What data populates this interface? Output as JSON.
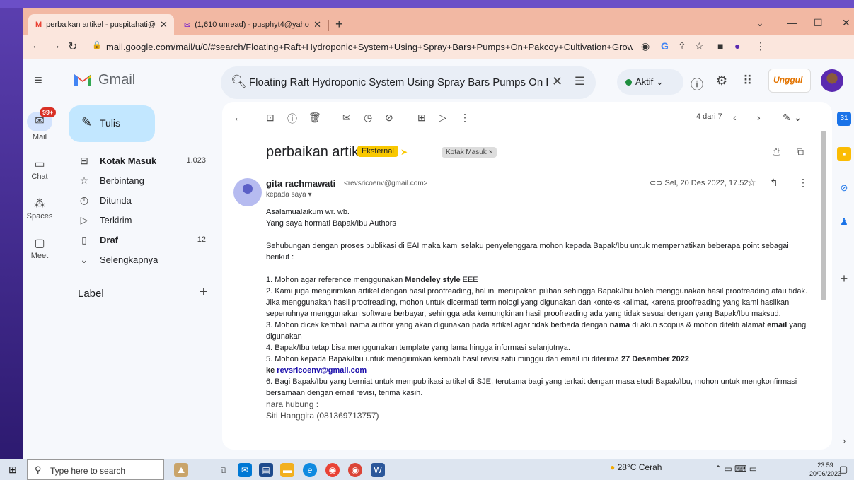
{
  "browser": {
    "tabs": [
      {
        "title": "perbaikan artikel - puspitahati@",
        "icon": "gmail-icon"
      },
      {
        "title": "(1,610 unread) - pusphyt4@yaho",
        "icon": "yahoo-mail-icon"
      }
    ],
    "new_tab": "+",
    "url": "mail.google.com/mail/u/0/#search/Floating+Raft+Hydroponic+System+Using+Spray+Bars+Pumps+On+Pakcoy+Cultivation+Growth+(Brassica+rapa+L)..."
  },
  "gmail": {
    "app_name": "Gmail",
    "search_query": "Floating Raft Hydroponic System Using Spray Bars Pumps On Pa",
    "status": "Aktif",
    "account_brand": "Unggul"
  },
  "rail": {
    "badge": "99+",
    "items": [
      {
        "label": "Mail",
        "icon": "mail-icon"
      },
      {
        "label": "Chat",
        "icon": "chat-icon"
      },
      {
        "label": "Spaces",
        "icon": "spaces-icon"
      },
      {
        "label": "Meet",
        "icon": "video-icon"
      }
    ]
  },
  "sidebar": {
    "compose": "Tulis",
    "items": [
      {
        "label": "Kotak Masuk",
        "count": "1.023",
        "icon": "inbox-icon"
      },
      {
        "label": "Berbintang",
        "count": "",
        "icon": "star-icon"
      },
      {
        "label": "Ditunda",
        "count": "",
        "icon": "clock-icon"
      },
      {
        "label": "Terkirim",
        "count": "",
        "icon": "send-icon"
      },
      {
        "label": "Draf",
        "count": "12",
        "icon": "draft-icon"
      },
      {
        "label": "Selengkapnya",
        "count": "",
        "icon": "chevron-down-icon"
      }
    ],
    "label_header": "Label"
  },
  "message": {
    "counter": "4 dari 7",
    "subject": "perbaikan artikel",
    "chip_external": "Eksternal",
    "chip_inbox": "Kotak Masuk ×",
    "sender_name": "gita rachmawati",
    "sender_email": "<revsricoenv@gmail.com>",
    "to": "kepada saya ▾",
    "date": "Sel, 20 Des 2022, 17.52",
    "greeting1": "Asalamualaikum wr. wb.",
    "greeting2": "Yang saya hormati Bapak/Ibu Authors",
    "intro": "Sehubungan dengan proses publikasi di EAI maka kami selaku penyelenggara mohon kepada Bapak/Ibu untuk memperhatikan beberapa point sebagai berikut :",
    "p1a": "1. Mohon agar reference menggunakan ",
    "p1b": "Mendeley style",
    "p1c": " EEE",
    "p2": "2. Kami juga mengirimkan artikel dengan hasil proofreading, hal ini merupakan pilihan sehingga Bapak/Ibu boleh menggunakan hasil  proofreading atau tidak. Jika menggunakan hasil proofreading, mohon untuk dicermati terminologi yang digunakan dan konteks kalimat, karena proofreading yang kami hasilkan sepenuhnya menggunakan software berbayar, sehingga ada kemungkinan hasil proofreading ada yang tidak sesuai dengan yang Bapak/Ibu maksud.",
    "p3a": "3. Mohon dicek kembali nama author yang akan digunakan pada artikel agar tidak berbeda dengan ",
    "p3b": "nama",
    "p3c": " di akun scopus & mohon diteliti alamat ",
    "p3d": "email",
    "p3e": " yang digunakan",
    "p4": "4. Bapak/Ibu tetap bisa menggunakan template yang lama hingga informasi selanjutnya.",
    "p5a": "5. Mohon kepada Bapak/Ibu untuk mengirimkan kembali hasil revisi satu minggu dari email ini diterima ",
    "p5b": "27 Desember 2022",
    "p5c": "ke ",
    "p5d": "revsricoenv@gmail.com",
    "p6": "6. Bagi Bapak/Ibu yang berniat untuk mempublikasi artikel di SJE, terutama bagi yang terkait dengan masa studi Bapak/Ibu, mohon untuk mengkonfirmasi bersamaan dengan email revisi, terima kasih.",
    "contact_label": "nara hubung :",
    "contact1": "Siti Hanggita (081369713757)"
  },
  "taskbar": {
    "search_placeholder": "Type here to search",
    "weather": "28°C  Cerah",
    "time": "23:59",
    "date": "20/06/2023"
  }
}
